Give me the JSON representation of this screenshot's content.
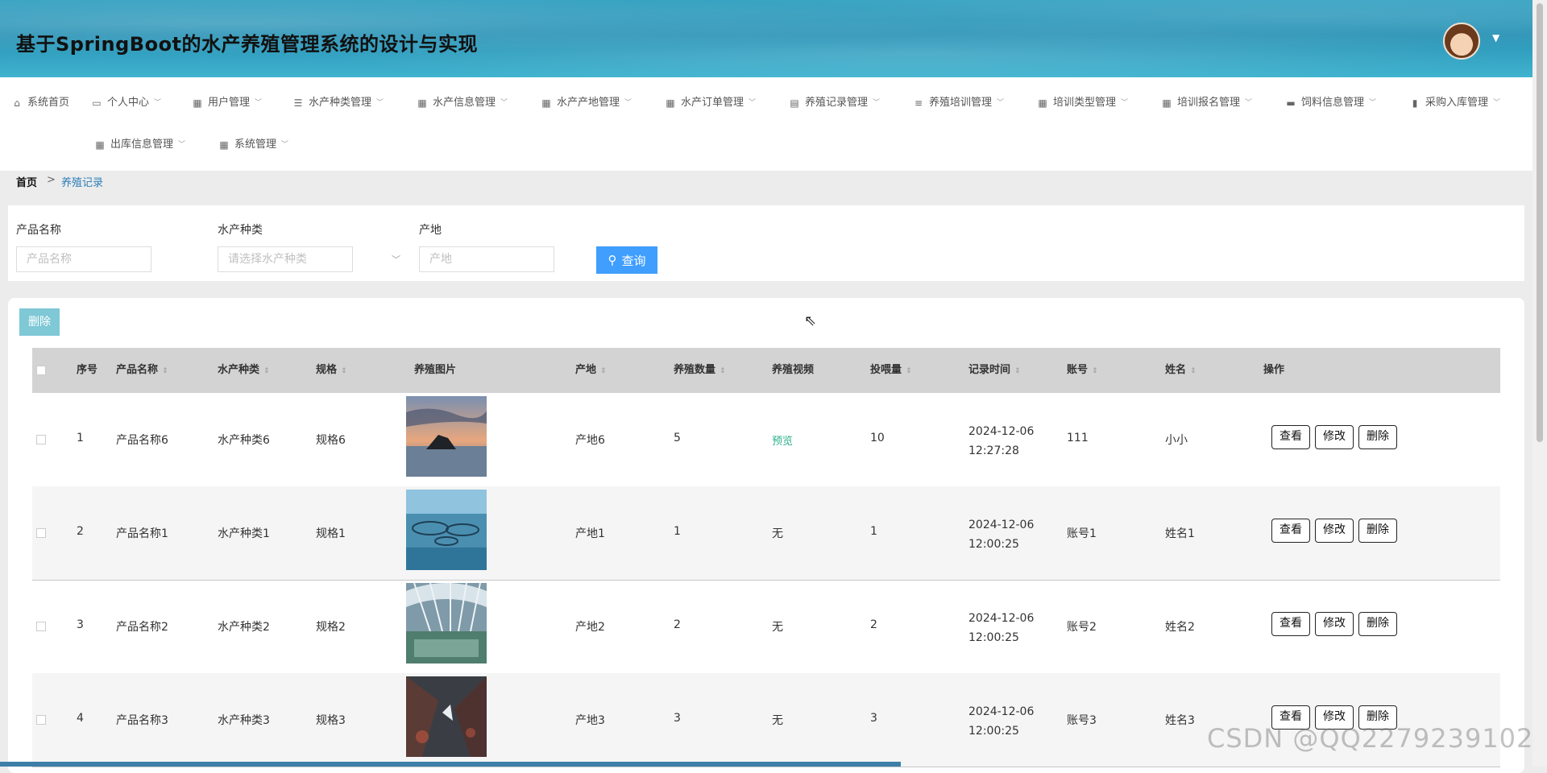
{
  "header": {
    "title": "基于SpringBoot的水产养殖管理系统的设计与实现"
  },
  "nav": {
    "items": [
      {
        "label": "系统首页",
        "icon": "home-icon"
      },
      {
        "label": "个人中心",
        "icon": "user-card-icon"
      },
      {
        "label": "用户管理",
        "icon": "grid-icon"
      },
      {
        "label": "水产种类管理",
        "icon": "list-icon"
      },
      {
        "label": "水产信息管理",
        "icon": "grid-icon"
      },
      {
        "label": "水产产地管理",
        "icon": "grid-icon"
      },
      {
        "label": "水产订单管理",
        "icon": "grid-icon"
      },
      {
        "label": "养殖记录管理",
        "icon": "clipboard-icon"
      },
      {
        "label": "养殖培训管理",
        "icon": "sliders-icon"
      },
      {
        "label": "培训类型管理",
        "icon": "grid-icon"
      },
      {
        "label": "培训报名管理",
        "icon": "grid-icon"
      },
      {
        "label": "饲料信息管理",
        "icon": "briefcase-icon"
      },
      {
        "label": "采购入库管理",
        "icon": "bar-chart-icon"
      },
      {
        "label": "出库信息管理",
        "icon": "grid-icon"
      },
      {
        "label": "系统管理",
        "icon": "grid-icon"
      }
    ]
  },
  "breadcrumb": {
    "home": "首页",
    "sep": ">",
    "current": "养殖记录"
  },
  "search": {
    "product_label": "产品名称",
    "product_placeholder": "产品名称",
    "species_label": "水产种类",
    "species_placeholder": "请选择水产种类",
    "origin_label": "产地",
    "origin_placeholder": "产地",
    "query_button": "查询"
  },
  "table": {
    "delete_button": "删除",
    "headers": [
      "序号",
      "产品名称",
      "水产种类",
      "规格",
      "养殖图片",
      "产地",
      "养殖数量",
      "养殖视频",
      "投喂量",
      "记录时间",
      "账号",
      "姓名",
      "操作"
    ],
    "rows": [
      {
        "no": "1",
        "product": "产品名称6",
        "species": "水产种类6",
        "spec": "规格6",
        "origin": "产地6",
        "qty": "5",
        "video": "预览",
        "feed": "10",
        "time": "2024-12-06 12:27:28",
        "account": "111",
        "name": "小小"
      },
      {
        "no": "2",
        "product": "产品名称1",
        "species": "水产种类1",
        "spec": "规格1",
        "origin": "产地1",
        "qty": "1",
        "video": "无",
        "feed": "1",
        "time": "2024-12-06 12:00:25",
        "account": "账号1",
        "name": "姓名1"
      },
      {
        "no": "3",
        "product": "产品名称2",
        "species": "水产种类2",
        "spec": "规格2",
        "origin": "产地2",
        "qty": "2",
        "video": "无",
        "feed": "2",
        "time": "2024-12-06 12:00:25",
        "account": "账号2",
        "name": "姓名2"
      },
      {
        "no": "4",
        "product": "产品名称3",
        "species": "水产种类3",
        "spec": "规格3",
        "origin": "产地3",
        "qty": "3",
        "video": "无",
        "feed": "3",
        "time": "2024-12-06 12:00:25",
        "account": "账号3",
        "name": "姓名3"
      }
    ],
    "actions": {
      "view": "查看",
      "edit": "修改",
      "delete": "删除"
    }
  },
  "watermark": "CSDN @QQ2279239102",
  "colors": {
    "primary": "#409eff",
    "delete_button": "#7fc8d6",
    "preview_link": "#2bb08a",
    "header_bg": "#2b93b6"
  }
}
